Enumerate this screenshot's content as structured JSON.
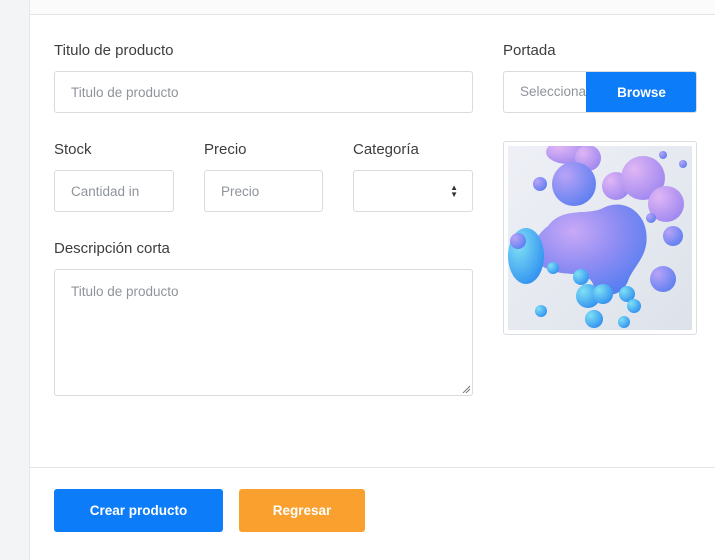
{
  "form": {
    "title_label": "Titulo de producto",
    "title_placeholder": "Titulo de producto",
    "cover_label": "Portada",
    "cover_file_text": "Seleccionar",
    "cover_browse": "Browse",
    "stock_label": "Stock",
    "stock_placeholder": "Cantidad in",
    "price_label": "Precio",
    "price_placeholder": "Precio",
    "category_label": "Categoría",
    "category_value": "",
    "desc_label": "Descripción corta",
    "desc_placeholder": "Titulo de producto"
  },
  "actions": {
    "create": "Crear producto",
    "back": "Regresar"
  },
  "colors": {
    "primary": "#0d7cf8",
    "warning": "#f9a02e"
  }
}
